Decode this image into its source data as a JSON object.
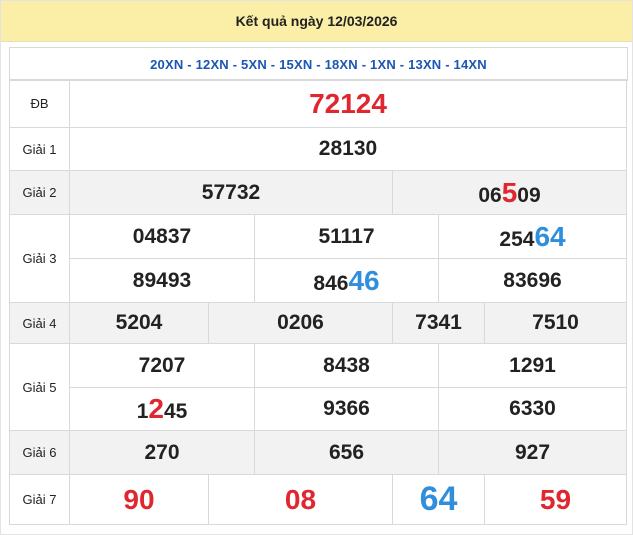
{
  "header": {
    "title": "Kết quả ngày 12/03/2026"
  },
  "codes": "20XN - 12XN - 5XN - 15XN - 18XN - 1XN - 13XN - 14XN",
  "rows": {
    "db": {
      "label": "ĐB",
      "value": "72124"
    },
    "g1": {
      "label": "Giải 1",
      "value": "28130"
    },
    "g2": {
      "label": "Giải 2",
      "n1": "57732",
      "n2_a": "06",
      "n2_b": "5",
      "n2_c": "09"
    },
    "g3": {
      "label": "Giải 3",
      "r1c1": "04837",
      "r1c2": "51117",
      "r1c3_a": "254",
      "r1c3_b": "64",
      "r2c1": "89493",
      "r2c2_a": "846",
      "r2c2_b": "46",
      "r2c3": "83696"
    },
    "g4": {
      "label": "Giải 4",
      "values": [
        "5204",
        "0206",
        "7341",
        "7510"
      ]
    },
    "g5": {
      "label": "Giải 5",
      "r1c1": "7207",
      "r1c2": "8438",
      "r1c3": "1291",
      "r2c1_a": "1",
      "r2c1_b": "2",
      "r2c1_c": "45",
      "r2c2": "9366",
      "r2c3": "6330"
    },
    "g6": {
      "label": "Giải 6",
      "values": [
        "270",
        "656",
        "927"
      ]
    },
    "g7": {
      "label": "Giải 7",
      "values": [
        "90",
        "08",
        "64",
        "59"
      ]
    }
  },
  "colors": {
    "header_bg": "#fbeea6",
    "codes_text": "#1a56b3",
    "highlight_red": "#e0262f",
    "highlight_blue": "#2f8fdc",
    "alt_row_bg": "#f2f2f2"
  }
}
